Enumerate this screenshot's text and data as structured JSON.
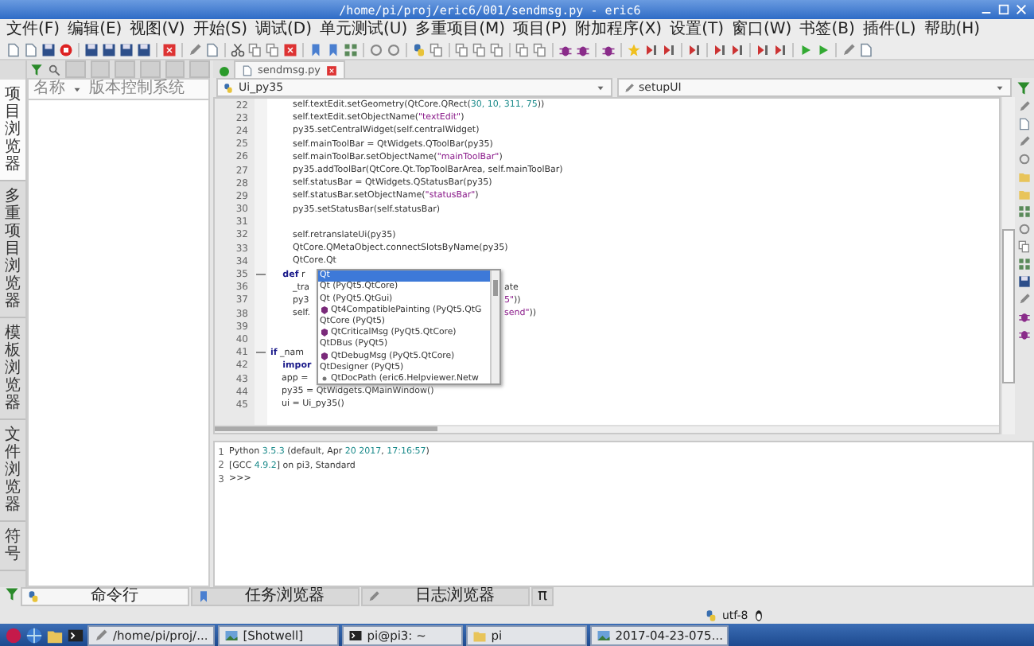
{
  "window": {
    "title": "/home/pi/proj/eric6/001/sendmsg.py - eric6"
  },
  "menu": [
    "文件(F)",
    "编辑(E)",
    "视图(V)",
    "开始(S)",
    "调试(D)",
    "单元测试(U)",
    "多重项目(M)",
    "项目(P)",
    "附加程序(X)",
    "设置(T)",
    "窗口(W)",
    "书签(B)",
    "插件(L)",
    "帮助(H)"
  ],
  "sidebar": {
    "tabs": [
      {
        "label": "项目浏览器",
        "selected": true
      },
      {
        "label": "多重项目浏览器",
        "selected": false
      },
      {
        "label": "模板浏览器",
        "selected": false
      },
      {
        "label": "文件浏览器",
        "selected": false
      },
      {
        "label": "符号",
        "selected": false
      }
    ],
    "columns": [
      "名称",
      "版本控制系统"
    ]
  },
  "editor": {
    "tabs": [
      {
        "label": "sendmsg.py",
        "selected": true
      }
    ],
    "class_combo": "Ui_py35",
    "method_combo": "setupUI",
    "lines": [
      {
        "number": "22",
        "fold": false,
        "tokens": [
          {
            "kind": "code",
            "text": "        self.textEdit.setGeometry(QtCore.QRect("
          },
          {
            "kind": "number",
            "text": "30, 10, 311, 75"
          },
          {
            "kind": "code",
            "text": "))"
          }
        ]
      },
      {
        "number": "23",
        "fold": false,
        "tokens": [
          {
            "kind": "code",
            "text": "        self.textEdit.setObjectName("
          },
          {
            "kind": "string",
            "text": "\"textEdit\""
          },
          {
            "kind": "code",
            "text": ")"
          }
        ]
      },
      {
        "number": "24",
        "fold": false,
        "tokens": [
          {
            "kind": "code",
            "text": "        py35.setCentralWidget(self.centralWidget)"
          }
        ]
      },
      {
        "number": "25",
        "fold": false,
        "tokens": [
          {
            "kind": "code",
            "text": "        self.mainToolBar = QtWidgets.QToolBar(py35)"
          }
        ]
      },
      {
        "number": "26",
        "fold": false,
        "tokens": [
          {
            "kind": "code",
            "text": "        self.mainToolBar.setObjectName("
          },
          {
            "kind": "string",
            "text": "\"mainToolBar\""
          },
          {
            "kind": "code",
            "text": ")"
          }
        ]
      },
      {
        "number": "27",
        "fold": false,
        "tokens": [
          {
            "kind": "code",
            "text": "        py35.addToolBar(QtCore.Qt.TopToolBarArea, self.mainToolBar)"
          }
        ]
      },
      {
        "number": "28",
        "fold": false,
        "tokens": [
          {
            "kind": "code",
            "text": "        self.statusBar = QtWidgets.QStatusBar(py35)"
          }
        ]
      },
      {
        "number": "29",
        "fold": false,
        "tokens": [
          {
            "kind": "code",
            "text": "        self.statusBar.setObjectName("
          },
          {
            "kind": "string",
            "text": "\"statusBar\""
          },
          {
            "kind": "code",
            "text": ")"
          }
        ]
      },
      {
        "number": "30",
        "fold": false,
        "tokens": [
          {
            "kind": "code",
            "text": "        py35.setStatusBar(self.statusBar)"
          }
        ]
      },
      {
        "number": "31",
        "fold": false
      },
      {
        "number": "32",
        "fold": false,
        "tokens": [
          {
            "kind": "code",
            "text": "        self.retranslateUi(py35)"
          }
        ]
      },
      {
        "number": "33",
        "fold": false,
        "tokens": [
          {
            "kind": "code",
            "text": "        QtCore.QMetaObject.connectSlotsByName(py35)"
          }
        ]
      },
      {
        "number": "34",
        "fold": false,
        "tokens": [
          {
            "kind": "code",
            "text": "        QtCore.Qt"
          }
        ]
      },
      {
        "number": "35",
        "fold": true,
        "tokens": [
          {
            "kind": "keyword",
            "text": "    def"
          },
          {
            "kind": "code",
            "text": " r"
          }
        ]
      },
      {
        "number": "36",
        "fold": false,
        "tokens": [
          {
            "kind": "code",
            "text": "        _tra"
          }
        ],
        "tail": [
          {
            "kind": "code",
            "text": "ate"
          }
        ]
      },
      {
        "number": "37",
        "fold": false,
        "tokens": [
          {
            "kind": "code",
            "text": "        py3"
          }
        ],
        "tail": [
          {
            "kind": "string",
            "text": "5\""
          },
          {
            "kind": "code",
            "text": "))"
          }
        ]
      },
      {
        "number": "38",
        "fold": false,
        "tokens": [
          {
            "kind": "code",
            "text": "        self."
          }
        ],
        "tail": [
          {
            "kind": "string",
            "text": "send\""
          },
          {
            "kind": "code",
            "text": "))"
          }
        ]
      },
      {
        "number": "39",
        "fold": false
      },
      {
        "number": "40",
        "fold": false
      },
      {
        "number": "41",
        "fold": true,
        "tokens": [
          {
            "kind": "keyword",
            "text": "if"
          },
          {
            "kind": "code",
            "text": " _nam"
          }
        ]
      },
      {
        "number": "42",
        "fold": false,
        "tokens": [
          {
            "kind": "keyword",
            "text": "    impor"
          }
        ]
      },
      {
        "number": "43",
        "fold": false,
        "tokens": [
          {
            "kind": "code",
            "text": "    app ="
          }
        ]
      },
      {
        "number": "44",
        "fold": false,
        "tokens": [
          {
            "kind": "code",
            "text": "    py35 = QtWidgets.QMainWindow()"
          }
        ]
      },
      {
        "number": "45",
        "fold": false,
        "tokens": [
          {
            "kind": "code",
            "text": "    ui = Ui_py35()"
          }
        ]
      }
    ],
    "completion": {
      "items": [
        {
          "label": "Qt",
          "kind": "plain",
          "selected": true
        },
        {
          "label": "Qt (PyQt5.QtCore)",
          "kind": "plain",
          "selected": false
        },
        {
          "label": "Qt (PyQt5.QtGui)",
          "kind": "plain",
          "selected": false
        },
        {
          "label": "Qt4CompatiblePainting (PyQt5.QtG",
          "kind": "class",
          "selected": false
        },
        {
          "label": "QtCore (PyQt5)",
          "kind": "plain",
          "selected": false
        },
        {
          "label": "QtCriticalMsg (PyQt5.QtCore)",
          "kind": "class",
          "selected": false
        },
        {
          "label": "QtDBus (PyQt5)",
          "kind": "plain",
          "selected": false
        },
        {
          "label": "QtDebugMsg (PyQt5.QtCore)",
          "kind": "class",
          "selected": false
        },
        {
          "label": "QtDesigner (PyQt5)",
          "kind": "plain",
          "selected": false
        },
        {
          "label": "QtDocPath (eric6.Helpviewer.Netw",
          "kind": "attribute",
          "selected": false
        }
      ]
    }
  },
  "shell": {
    "lines": [
      {
        "number": "1",
        "tokens": [
          {
            "kind": "code",
            "text": "Python "
          },
          {
            "kind": "number",
            "text": "3.5.3"
          },
          {
            "kind": "code",
            "text": " (default, Apr "
          },
          {
            "kind": "number",
            "text": "20 2017"
          },
          {
            "kind": "code",
            "text": ", "
          },
          {
            "kind": "number",
            "text": "17:16:57"
          },
          {
            "kind": "code",
            "text": ")"
          }
        ]
      },
      {
        "number": "2",
        "tokens": [
          {
            "kind": "code",
            "text": "[GCC "
          },
          {
            "kind": "number",
            "text": "4.9.2"
          },
          {
            "kind": "code",
            "text": "] on pi3, Standard"
          }
        ]
      },
      {
        "number": "3",
        "tokens": [
          {
            "kind": "code",
            "text": ">>>"
          }
        ]
      }
    ]
  },
  "bottom_tabs": [
    {
      "label": "命令行",
      "selected": true
    },
    {
      "label": "任务浏览器",
      "selected": false
    },
    {
      "label": "日志浏览器",
      "selected": false
    },
    {
      "label": "π",
      "selected": false
    }
  ],
  "status_bar": {
    "encoding": "utf-8"
  },
  "taskbar": {
    "windows": [
      {
        "label": "/home/pi/proj/..."
      },
      {
        "label": "[Shotwell]"
      },
      {
        "label": "pi@pi3: ~"
      },
      {
        "label": "pi"
      },
      {
        "label": "2017-04-23-075..."
      }
    ]
  }
}
